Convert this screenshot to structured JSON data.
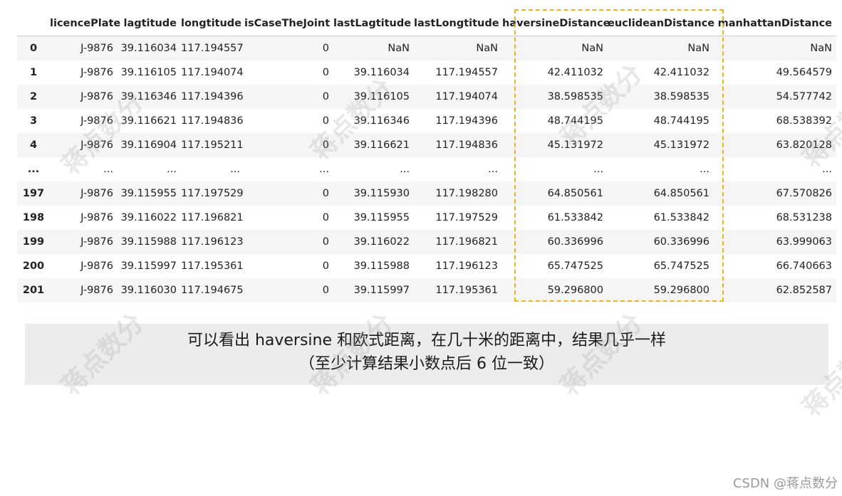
{
  "table": {
    "columns": [
      "",
      "licencePlate",
      "lagtitude",
      "longtitude",
      "isCaseTheJoint",
      "lastLagtitude",
      "lastLongtitude",
      "haversineDistance",
      "euclideanDistance",
      "manhattanDistance"
    ],
    "rows": [
      [
        "0",
        "J-9876",
        "39.116034",
        "117.194557",
        "0",
        "NaN",
        "NaN",
        "NaN",
        "NaN",
        "NaN"
      ],
      [
        "1",
        "J-9876",
        "39.116105",
        "117.194074",
        "0",
        "39.116034",
        "117.194557",
        "42.411032",
        "42.411032",
        "49.564579"
      ],
      [
        "2",
        "J-9876",
        "39.116346",
        "117.194396",
        "0",
        "39.116105",
        "117.194074",
        "38.598535",
        "38.598535",
        "54.577742"
      ],
      [
        "3",
        "J-9876",
        "39.116621",
        "117.194836",
        "0",
        "39.116346",
        "117.194396",
        "48.744195",
        "48.744195",
        "68.538392"
      ],
      [
        "4",
        "J-9876",
        "39.116904",
        "117.195211",
        "0",
        "39.116621",
        "117.194836",
        "45.131972",
        "45.131972",
        "63.820128"
      ],
      [
        "...",
        "...",
        "...",
        "...",
        "...",
        "...",
        "...",
        "...",
        "...",
        "..."
      ],
      [
        "197",
        "J-9876",
        "39.115955",
        "117.197529",
        "0",
        "39.115930",
        "117.198280",
        "64.850561",
        "64.850561",
        "67.570826"
      ],
      [
        "198",
        "J-9876",
        "39.116022",
        "117.196821",
        "0",
        "39.115955",
        "117.197529",
        "61.533842",
        "61.533842",
        "68.531238"
      ],
      [
        "199",
        "J-9876",
        "39.115988",
        "117.196123",
        "0",
        "39.116022",
        "117.196821",
        "60.336996",
        "60.336996",
        "63.999063"
      ],
      [
        "200",
        "J-9876",
        "39.115997",
        "117.195361",
        "0",
        "39.115988",
        "117.196123",
        "65.747525",
        "65.747525",
        "66.740663"
      ],
      [
        "201",
        "J-9876",
        "39.116030",
        "117.194675",
        "0",
        "39.115997",
        "117.195361",
        "59.296800",
        "59.296800",
        "62.852587"
      ]
    ]
  },
  "note": {
    "line1": "可以看出 haversine 和欧式距离，在几十米的距离中，结果几乎一样",
    "line2": "（至少计算结果小数点后 6 位一致）"
  },
  "watermark_text": "蒋点数分",
  "credit": "CSDN @蒋点数分",
  "colors": {
    "highlight_border": "#e8b325",
    "stripe": "#f5f5f5",
    "note_bg": "#ececec"
  }
}
